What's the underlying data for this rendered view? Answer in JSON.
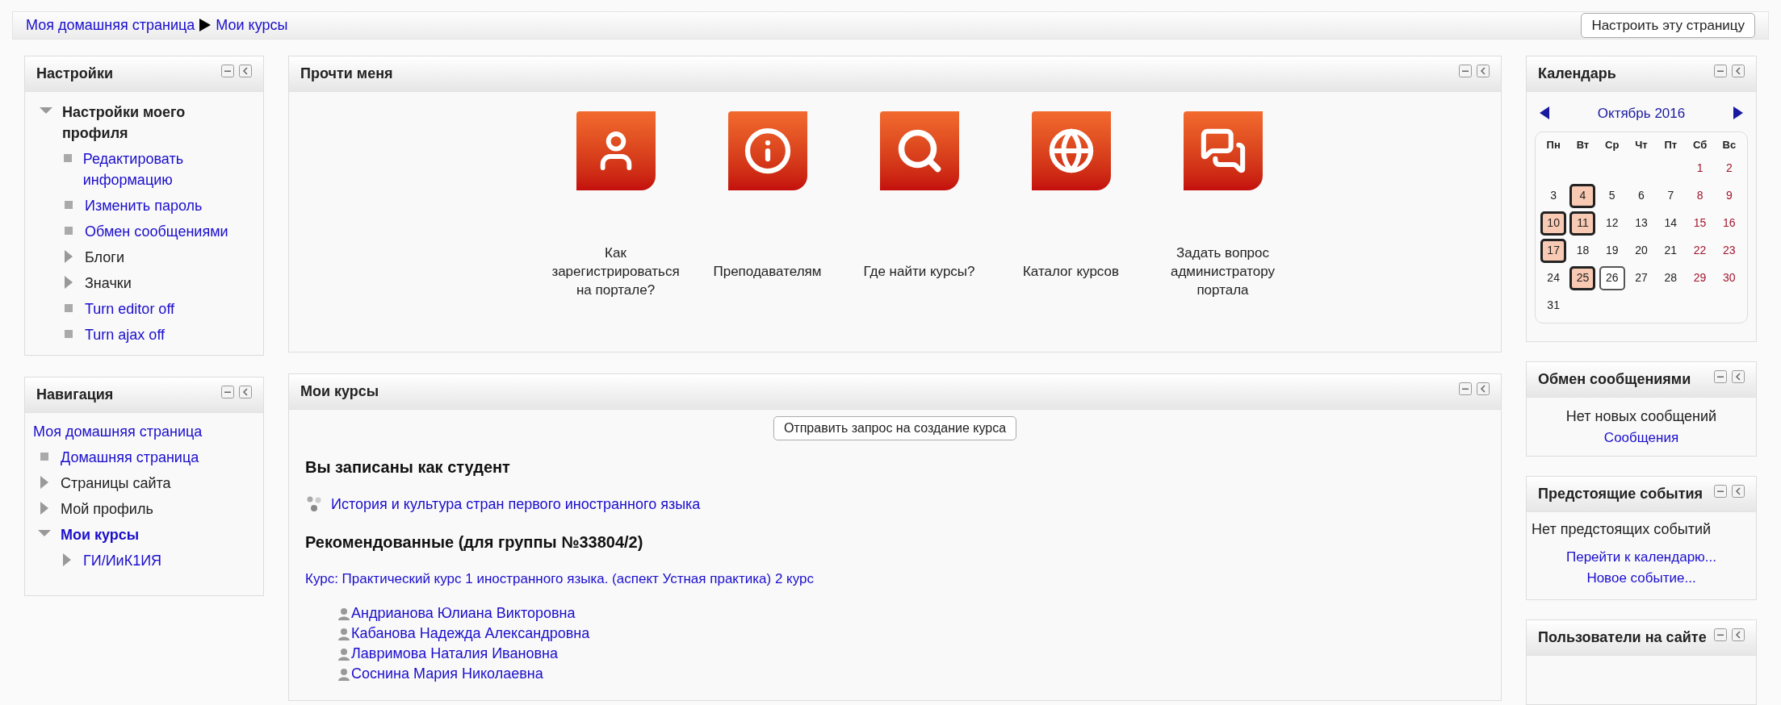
{
  "breadcrumb": [
    "Моя домашняя страница",
    "Мои курсы"
  ],
  "customize_button": "Настроить эту страницу",
  "settings_block": {
    "title": "Настройки",
    "tree": [
      {
        "label": "Настройки моего профиля",
        "kind": "branch",
        "expanded": true,
        "link": false,
        "children": [
          {
            "label": "Редактировать информацию",
            "kind": "leaf",
            "link": true
          },
          {
            "label": "Изменить пароль",
            "kind": "leaf",
            "link": true
          },
          {
            "label": "Обмен сообщениями",
            "kind": "leaf",
            "link": true
          },
          {
            "label": "Блоги",
            "kind": "branch",
            "expanded": false,
            "link": false
          },
          {
            "label": "Значки",
            "kind": "branch",
            "expanded": false,
            "link": false
          },
          {
            "label": "Turn editor off",
            "kind": "leaf",
            "link": true
          },
          {
            "label": "Turn ajax off",
            "kind": "leaf",
            "link": true
          }
        ]
      }
    ]
  },
  "navigation_block": {
    "title": "Навигация",
    "home": "Моя домашняя страница",
    "tree": [
      {
        "label": "Домашняя страница",
        "kind": "leaf",
        "link": true
      },
      {
        "label": "Страницы сайта",
        "kind": "branch",
        "expanded": false,
        "link": false
      },
      {
        "label": "Мой профиль",
        "kind": "branch",
        "expanded": false,
        "link": false
      },
      {
        "label": "Мои курсы",
        "kind": "branch",
        "expanded": true,
        "link": true,
        "children": [
          {
            "label": "ГИ/ИиК1ИЯ",
            "kind": "branch",
            "expanded": false,
            "link": true
          }
        ]
      }
    ]
  },
  "readme_block": {
    "title": "Прочти меня",
    "tiles": [
      {
        "kind": "person",
        "label": "Как зарегистрироваться на портале?"
      },
      {
        "kind": "info",
        "label": "Преподавателям"
      },
      {
        "kind": "search",
        "label": "Где найти курсы?"
      },
      {
        "kind": "globe",
        "label": "Каталог курсов"
      },
      {
        "kind": "chat",
        "label": "Задать вопрос администратору портала"
      }
    ]
  },
  "courses_block": {
    "title": "Мои курсы",
    "request_button": "Отправить запрос на создание курса",
    "enrolled_heading": "Вы записаны как студент",
    "enrolled": [
      "История и культура стран первого иностранного языка"
    ],
    "recommended_heading": "Рекомендованные (для группы №33804/2)",
    "recommended_course": "Курс: Практический курс 1 иностранного языка. (аспект Устная практика) 2 курс",
    "teachers": [
      "Андрианова Юлиана Викторовна",
      "Кабанова Надежда Александровна",
      "Лавримова Наталия Ивановна",
      "Соснина Мария Николаевна"
    ]
  },
  "calendar_block": {
    "title": "Календарь",
    "month": "Октябрь 2016",
    "weekdays": [
      "Пн",
      "Вт",
      "Ср",
      "Чт",
      "Пт",
      "Сб",
      "Вс"
    ],
    "weeks": [
      {
        "kind": "leading",
        "days": [
          {
            "day": "1",
            "event": false,
            "today": false
          },
          {
            "day": "2",
            "event": false,
            "today": false
          }
        ]
      },
      {
        "kind": "full",
        "days": [
          {
            "day": "3",
            "event": false,
            "today": false
          },
          {
            "day": "4",
            "event": true,
            "today": false
          },
          {
            "day": "5",
            "event": false,
            "today": false
          },
          {
            "day": "6",
            "event": false,
            "today": false
          },
          {
            "day": "7",
            "event": false,
            "today": false
          },
          {
            "day": "8",
            "event": false,
            "today": false
          },
          {
            "day": "9",
            "event": false,
            "today": false
          }
        ]
      },
      {
        "kind": "full",
        "days": [
          {
            "day": "10",
            "event": true,
            "today": false
          },
          {
            "day": "11",
            "event": true,
            "today": false
          },
          {
            "day": "12",
            "event": false,
            "today": false
          },
          {
            "day": "13",
            "event": false,
            "today": false
          },
          {
            "day": "14",
            "event": false,
            "today": false
          },
          {
            "day": "15",
            "event": false,
            "today": false
          },
          {
            "day": "16",
            "event": false,
            "today": false
          }
        ]
      },
      {
        "kind": "full",
        "days": [
          {
            "day": "17",
            "event": true,
            "today": false
          },
          {
            "day": "18",
            "event": false,
            "today": false
          },
          {
            "day": "19",
            "event": false,
            "today": false
          },
          {
            "day": "20",
            "event": false,
            "today": false
          },
          {
            "day": "21",
            "event": false,
            "today": false
          },
          {
            "day": "22",
            "event": false,
            "today": false
          },
          {
            "day": "23",
            "event": false,
            "today": false
          }
        ]
      },
      {
        "kind": "full",
        "days": [
          {
            "day": "24",
            "event": false,
            "today": false
          },
          {
            "day": "25",
            "event": true,
            "today": false
          },
          {
            "day": "26",
            "event": false,
            "today": true
          },
          {
            "day": "27",
            "event": false,
            "today": false
          },
          {
            "day": "28",
            "event": false,
            "today": false
          },
          {
            "day": "29",
            "event": false,
            "today": false
          },
          {
            "day": "30",
            "event": false,
            "today": false
          }
        ]
      },
      {
        "kind": "trailing",
        "days": [
          {
            "day": "31",
            "event": false,
            "today": false
          }
        ]
      }
    ]
  },
  "messages_block": {
    "title": "Обмен сообщениями",
    "text": "Нет новых сообщений",
    "link": "Сообщения"
  },
  "events_block": {
    "title": "Предстоящие события",
    "text": "Нет предстоящих событий",
    "links": [
      "Перейти к календарю...",
      "Новое событие..."
    ]
  },
  "online_block": {
    "title": "Пользователи на сайте"
  }
}
